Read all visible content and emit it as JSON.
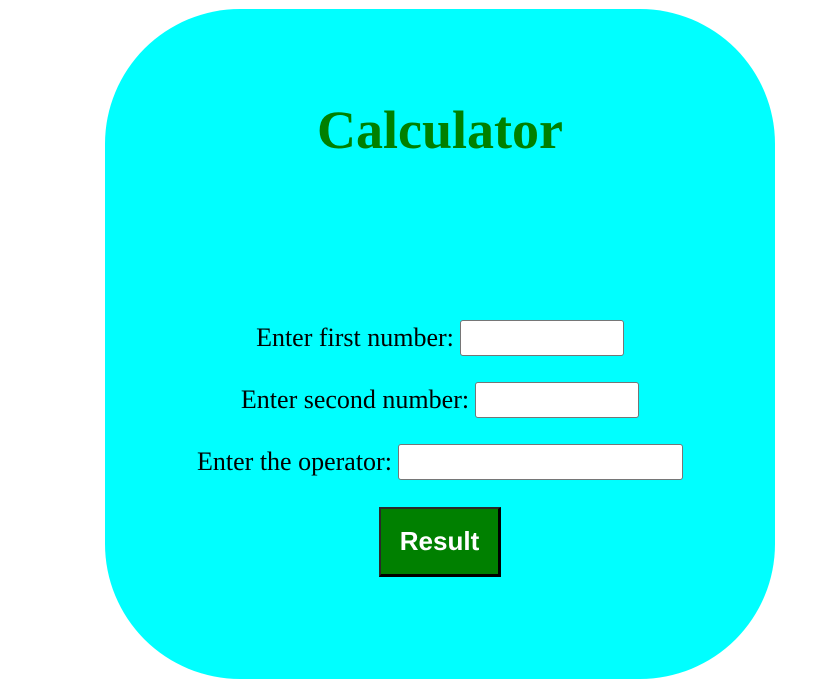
{
  "app": {
    "title": "Calculator"
  },
  "form": {
    "first_label": "Enter first number:",
    "first_value": "",
    "second_label": "Enter second number:",
    "second_value": "",
    "operator_label": "Enter the operator:",
    "operator_value": "",
    "submit_label": "Result"
  },
  "colors": {
    "card_background": "#00ffff",
    "title": "#008000",
    "button_background": "#008000",
    "button_text": "#ffffff"
  }
}
